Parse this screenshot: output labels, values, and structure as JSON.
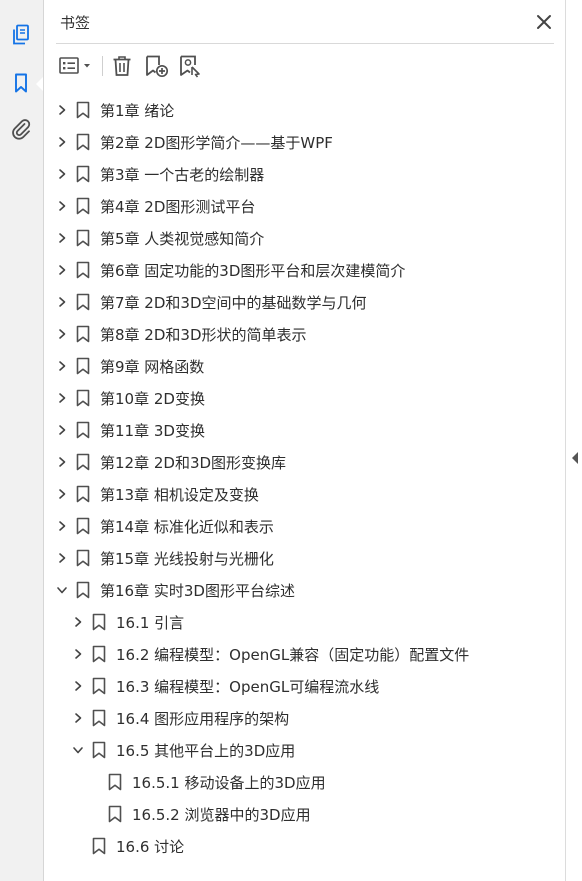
{
  "panel": {
    "title": "书签",
    "close_glyph": "×"
  },
  "icons": {
    "rail": [
      "pages-icon",
      "bookmarks-icon",
      "attachments-icon"
    ],
    "toolbar": [
      "options-menu-icon",
      "delete-icon",
      "new-bookmark-icon",
      "new-bookmark-from-structure-icon"
    ],
    "tree": [
      "chevron-right-icon",
      "chevron-down-icon",
      "bookmark-icon"
    ]
  },
  "colors": {
    "accent": "#1473e6",
    "rail_bg": "#f1f1f1",
    "icon_gray": "#505050",
    "text": "#2e2e2e"
  },
  "bookmarks": [
    {
      "label": "第1章 绪论",
      "level": 0,
      "state": "collapsed"
    },
    {
      "label": "第2章 2D图形学简介——基于WPF",
      "level": 0,
      "state": "collapsed"
    },
    {
      "label": "第3章 一个古老的绘制器",
      "level": 0,
      "state": "collapsed"
    },
    {
      "label": "第4章 2D图形测试平台",
      "level": 0,
      "state": "collapsed"
    },
    {
      "label": "第5章 人类视觉感知简介",
      "level": 0,
      "state": "collapsed"
    },
    {
      "label": "第6章 固定功能的3D图形平台和层次建模简介",
      "level": 0,
      "state": "collapsed"
    },
    {
      "label": "第7章 2D和3D空间中的基础数学与几何",
      "level": 0,
      "state": "collapsed"
    },
    {
      "label": "第8章 2D和3D形状的简单表示",
      "level": 0,
      "state": "collapsed"
    },
    {
      "label": "第9章 网格函数",
      "level": 0,
      "state": "collapsed"
    },
    {
      "label": "第10章 2D变换",
      "level": 0,
      "state": "collapsed"
    },
    {
      "label": "第11章 3D变换",
      "level": 0,
      "state": "collapsed"
    },
    {
      "label": "第12章 2D和3D图形变换库",
      "level": 0,
      "state": "collapsed"
    },
    {
      "label": "第13章 相机设定及变换",
      "level": 0,
      "state": "collapsed"
    },
    {
      "label": "第14章 标准化近似和表示",
      "level": 0,
      "state": "collapsed"
    },
    {
      "label": "第15章 光线投射与光栅化",
      "level": 0,
      "state": "collapsed"
    },
    {
      "label": "第16章 实时3D图形平台综述",
      "level": 0,
      "state": "expanded"
    },
    {
      "label": "16.1 引言",
      "level": 1,
      "state": "collapsed"
    },
    {
      "label": "16.2 编程模型：OpenGL兼容（固定功能）配置文件",
      "level": 1,
      "state": "collapsed"
    },
    {
      "label": "16.3 编程模型：OpenGL可编程流水线",
      "level": 1,
      "state": "collapsed"
    },
    {
      "label": "16.4 图形应用程序的架构",
      "level": 1,
      "state": "collapsed"
    },
    {
      "label": "16.5 其他平台上的3D应用",
      "level": 1,
      "state": "expanded"
    },
    {
      "label": "16.5.1 移动设备上的3D应用",
      "level": 2,
      "state": "leaf"
    },
    {
      "label": "16.5.2 浏览器中的3D应用",
      "level": 2,
      "state": "leaf"
    },
    {
      "label": "16.6 讨论",
      "level": 1,
      "state": "leaf"
    }
  ]
}
